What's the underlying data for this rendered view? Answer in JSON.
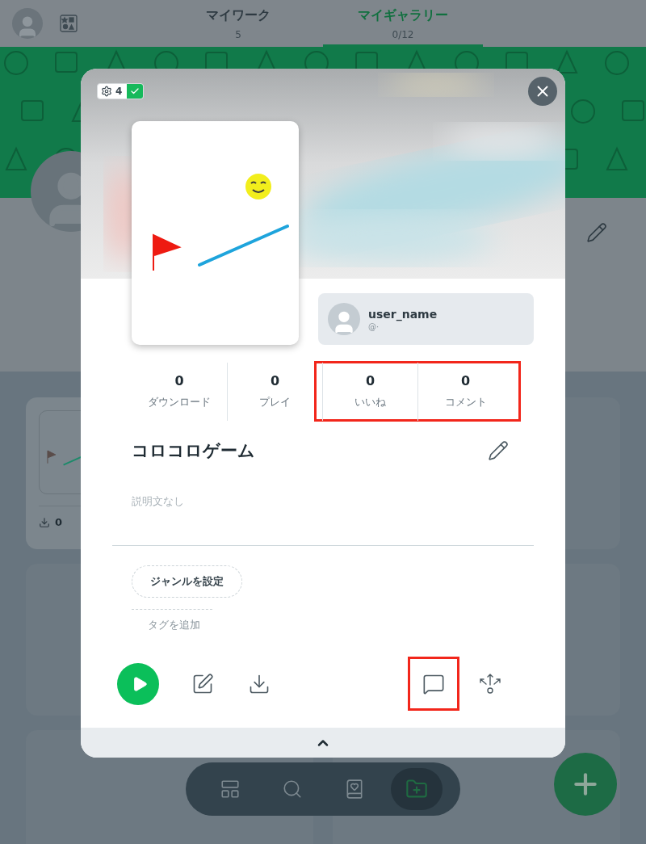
{
  "header": {
    "tabs": [
      {
        "label": "マイワーク",
        "count": "5",
        "selected": false
      },
      {
        "label": "マイギャラリー",
        "count": "0/12",
        "selected": true
      }
    ]
  },
  "gallery": {
    "cards": [
      {
        "kind": "work",
        "downloads": "0"
      },
      {
        "kind": "empty"
      },
      {
        "kind": "empty"
      },
      {
        "kind": "empty"
      },
      {
        "kind": "empty"
      },
      {
        "kind": "empty"
      }
    ]
  },
  "bottom_nav": {
    "items": [
      {
        "kind": "layout",
        "selected": false
      },
      {
        "kind": "search",
        "selected": false
      },
      {
        "kind": "album",
        "selected": false
      },
      {
        "kind": "add-folder",
        "selected": true
      }
    ]
  },
  "modal": {
    "badge": {
      "count": "4",
      "checked": true
    },
    "user": {
      "name": "user_name",
      "handle": "@·"
    },
    "stats": [
      {
        "value": "0",
        "label": "ダウンロード",
        "highlighted": false
      },
      {
        "value": "0",
        "label": "プレイ",
        "highlighted": false
      },
      {
        "value": "0",
        "label": "いいね",
        "highlighted": true
      },
      {
        "value": "0",
        "label": "コメント",
        "highlighted": true
      }
    ],
    "title": "コロコロゲーム",
    "description": {
      "placeholder": "説明文なし"
    },
    "genre_button": "ジャンルを設定",
    "tag_link": "タグを追加",
    "actions": [
      {
        "kind": "play",
        "highlighted": false
      },
      {
        "kind": "edit",
        "highlighted": false
      },
      {
        "kind": "download",
        "highlighted": false
      },
      {
        "kind": "comment",
        "highlighted": true
      },
      {
        "kind": "share",
        "highlighted": false
      }
    ]
  }
}
